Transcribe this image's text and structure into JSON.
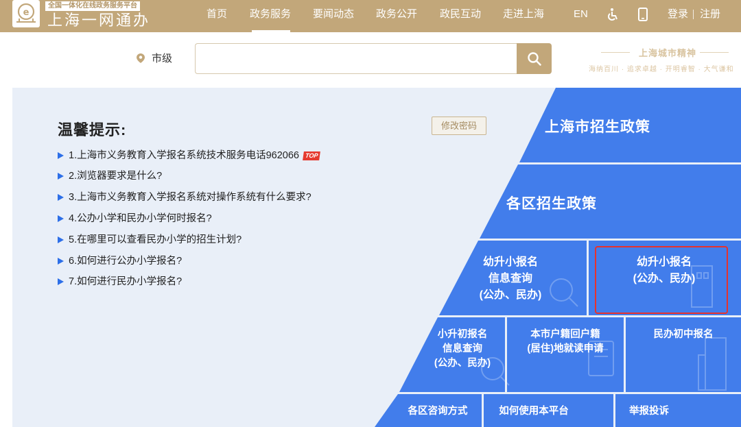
{
  "header": {
    "platform_tag": "全国一体化在线政务服务平台",
    "site_name": "上海一网通办",
    "nav": [
      {
        "label": "首页"
      },
      {
        "label": "政务服务",
        "active": true
      },
      {
        "label": "要闻动态"
      },
      {
        "label": "政务公开"
      },
      {
        "label": "政民互动"
      },
      {
        "label": "走进上海"
      }
    ],
    "lang_label": "EN",
    "accessibility_icon": "wheelchair-icon",
    "mobile_icon": "mobile-phone-icon",
    "login_label": "登录",
    "register_label": "注册",
    "brand_color": "#c2a77a"
  },
  "search": {
    "location_icon": "map-pin-icon",
    "location_label": "市级",
    "placeholder": "",
    "value": "",
    "button_icon": "search-icon"
  },
  "slogan": {
    "title": "上海城市精神",
    "subtitle": "海纳百川 · 追求卓越 · 开明睿智 · 大气谦和"
  },
  "tips": {
    "title": "温馨提示:",
    "change_password_label": "修改密码",
    "items": [
      {
        "text": "1.上海市义务教育入学报名系统技术服务电话962066",
        "badge": "TOP"
      },
      {
        "text": "2.浏览器要求是什么?"
      },
      {
        "text": "3.上海市义务教育入学报名系统对操作系统有什么要求?"
      },
      {
        "text": "4.公办小学和民办小学何时报名?"
      },
      {
        "text": "5.在哪里可以查看民办小学的招生计划?"
      },
      {
        "text": "6.如何进行公办小学报名?"
      },
      {
        "text": "7.如何进行民办小学报名?"
      }
    ]
  },
  "tiles": {
    "city_policy": "上海市招生政策",
    "district_policy": "各区招生政策",
    "primary_query": [
      "幼升小报名",
      "信息查询",
      "(公办、民办)"
    ],
    "primary_signup": [
      "幼升小报名",
      "(公办、民办)"
    ],
    "middle_query": [
      "小升初报名",
      "信息查询",
      "(公办、民办)"
    ],
    "hukou_return": [
      "本市户籍回户籍",
      "(居住)地就读申请"
    ],
    "private_middle": "民办初中报名",
    "district_contact": "各区咨询方式",
    "how_to_use": "如何使用本平台",
    "report": "举报投诉",
    "tile_color": "#3574ea",
    "highlight_color": "#e8322b"
  }
}
